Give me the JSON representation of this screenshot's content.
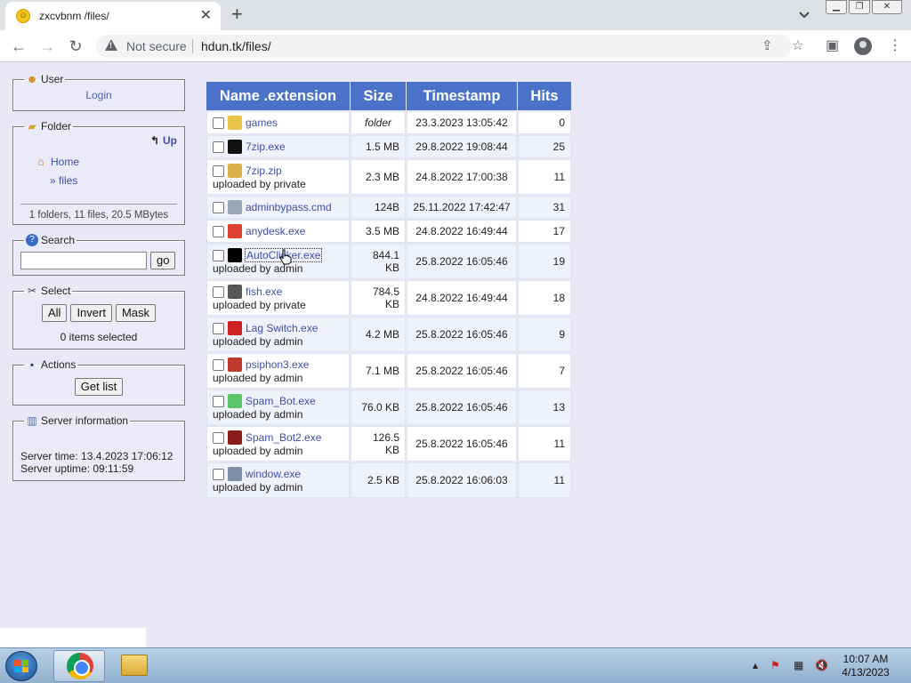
{
  "browser": {
    "tab_title": "zxcvbnm /files/",
    "tab_close": "✕",
    "new_tab": "+",
    "security_label": "Not secure",
    "url": "hdun.tk/files/"
  },
  "sidebar": {
    "user": {
      "legend": "User",
      "login": "Login"
    },
    "folder": {
      "legend": "Folder",
      "up": "Up",
      "home": "Home",
      "current": "» files",
      "stats": "1 folders, 11 files, 20.5 MBytes"
    },
    "search": {
      "legend": "Search",
      "value": "",
      "go": "go"
    },
    "select": {
      "legend": "Select",
      "all": "All",
      "invert": "Invert",
      "mask": "Mask",
      "count": "0 items selected"
    },
    "actions": {
      "legend": "Actions",
      "get_list": "Get list"
    },
    "server": {
      "legend": "Server information",
      "time": "Server time: 13.4.2023 17:06:12",
      "uptime": "Server uptime: 09:11:59"
    }
  },
  "table": {
    "headers": {
      "name": "Name .extension",
      "size": "Size",
      "timestamp": "Timestamp",
      "hits": "Hits"
    },
    "rows": [
      {
        "name": "games",
        "uploader": "",
        "size": "folder",
        "timestamp": "23.3.2023 13:05:42",
        "hits": "0",
        "icon": "folder-icon",
        "icon_color": "#e8c54a"
      },
      {
        "name": "7zip.exe",
        "uploader": "",
        "size": "1.5 MB",
        "timestamp": "29.8.2022 19:08:44",
        "hits": "25",
        "icon": "7zip-icon",
        "icon_color": "#111111"
      },
      {
        "name": "7zip.zip",
        "uploader": "uploaded by private",
        "size": "2.3 MB",
        "timestamp": "24.8.2022 17:00:38",
        "hits": "11",
        "icon": "zip-icon",
        "icon_color": "#d8b04a"
      },
      {
        "name": "adminbypass.cmd",
        "uploader": "",
        "size": "124B",
        "timestamp": "25.11.2022 17:42:47",
        "hits": "31",
        "icon": "cmd-icon",
        "icon_color": "#9aa7b8"
      },
      {
        "name": "anydesk.exe",
        "uploader": "",
        "size": "3.5 MB",
        "timestamp": "24.8.2022 16:49:44",
        "hits": "17",
        "icon": "anydesk-icon",
        "icon_color": "#e0402f"
      },
      {
        "name": "AutoClicker.exe",
        "uploader": "uploaded by admin",
        "size": "844.1 KB",
        "timestamp": "25.8.2022 16:05:46",
        "hits": "19",
        "icon": "autoclicker-icon",
        "icon_color": "#000000"
      },
      {
        "name": "fish.exe",
        "uploader": "uploaded by private",
        "size": "784.5 KB",
        "timestamp": "24.8.2022 16:49:44",
        "hits": "18",
        "icon": "fish-icon",
        "icon_color": "#555555"
      },
      {
        "name": "Lag Switch.exe",
        "uploader": "uploaded by admin",
        "size": "4.2 MB",
        "timestamp": "25.8.2022 16:05:46",
        "hits": "9",
        "icon": "lagswitch-icon",
        "icon_color": "#cc2222"
      },
      {
        "name": "psiphon3.exe",
        "uploader": "uploaded by admin",
        "size": "7.1 MB",
        "timestamp": "25.8.2022 16:05:46",
        "hits": "7",
        "icon": "psiphon-icon",
        "icon_color": "#c0392b"
      },
      {
        "name": "Spam_Bot.exe",
        "uploader": "uploaded by admin",
        "size": "76.0 KB",
        "timestamp": "25.8.2022 16:05:46",
        "hits": "13",
        "icon": "spambot-icon",
        "icon_color": "#5cc46a"
      },
      {
        "name": "Spam_Bot2.exe",
        "uploader": "uploaded by admin",
        "size": "126.5 KB",
        "timestamp": "25.8.2022 16:05:46",
        "hits": "11",
        "icon": "spambot2-icon",
        "icon_color": "#8b1a1a"
      },
      {
        "name": "window.exe",
        "uploader": "uploaded by admin",
        "size": "2.5 KB",
        "timestamp": "25.8.2022 16:06:03",
        "hits": "11",
        "icon": "window-icon",
        "icon_color": "#7f8fa8"
      }
    ]
  },
  "taskbar": {
    "time": "10:07 AM",
    "date": "4/13/2023"
  }
}
